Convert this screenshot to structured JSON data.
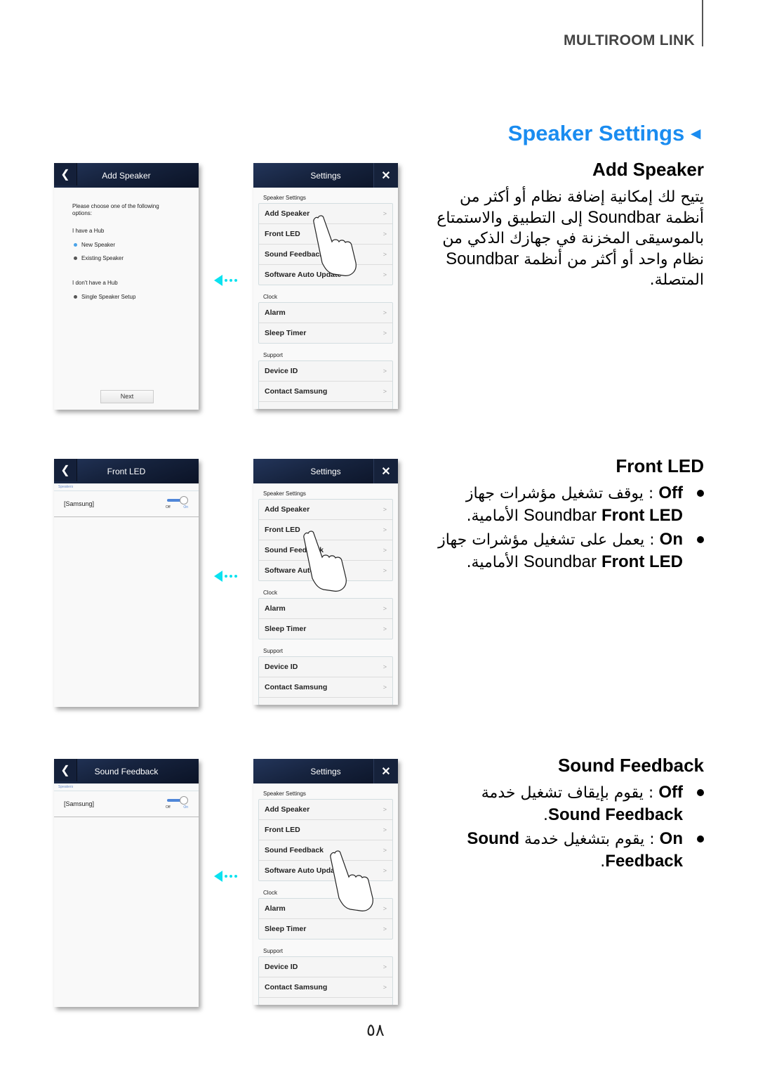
{
  "header": {
    "section": "MULTIROOM LINK"
  },
  "title": {
    "text": "Speaker Settings",
    "marker": "◄",
    "color": "#1a8cf0"
  },
  "accent_arrow_color": "#0ae2f0",
  "add_speaker": {
    "heading": "Add Speaker",
    "paragraph_parts": [
      "يتيح لك إمكانية إضافة نظام أو أكثر من أنظمة ",
      "Soundbar",
      " إلى التطبيق والاستمتاع بالموسيقى المخزنة في جهازك الذكي من نظام واحد أو أكثر من أنظمة ",
      "Soundbar",
      " المتصلة."
    ],
    "phone": {
      "title": "Add Speaker",
      "prompt": "Please choose one of the following options:",
      "group1": "I have a Hub",
      "opt_new": "New Speaker",
      "opt_existing": "Existing Speaker",
      "group2": "I don't have a Hub",
      "opt_single": "Single Speaker Setup",
      "next": "Next"
    }
  },
  "settings_menu": {
    "title": "Settings",
    "close": "✕",
    "group_speaker": "Speaker Settings",
    "items_speaker": [
      "Add Speaker",
      "Front LED",
      "Sound Feedback",
      "Software Auto Update"
    ],
    "group_clock": "Clock",
    "items_clock": [
      "Alarm",
      "Sleep Timer"
    ],
    "group_support": "Support",
    "items_support": [
      "Device ID",
      "Contact Samsung"
    ],
    "chevron": ">"
  },
  "front_led": {
    "heading": "Front LED",
    "phone": {
      "title": "Front LED",
      "speakers_label": "Speakers",
      "speaker": "[Samsung]",
      "off": "Off",
      "on": "On",
      "state": "on"
    },
    "bullets": [
      {
        "key": "Off",
        "sep": " : ",
        "text": "يوقف تشغيل مؤشرات جهاز ",
        "latin": "Soundbar",
        "bold": "Front LED",
        "tail": " الأمامية."
      },
      {
        "key": "On",
        "sep": " : ",
        "text": "يعمل على تشغيل مؤشرات جهاز ",
        "latin": "Soundbar",
        "bold": "Front LED",
        "tail": " الأمامية."
      }
    ]
  },
  "sound_feedback": {
    "heading": "Sound Feedback",
    "phone": {
      "title": "Sound Feedback",
      "speakers_label": "Speakers",
      "speaker": "[Samsung]",
      "off": "Off",
      "on": "On",
      "state": "on"
    },
    "bullets": [
      {
        "key": "Off",
        "sep": " : ",
        "text": "يقوم بإيقاف تشغيل خدمة ",
        "bold": "Sound Feedback",
        "tail": "."
      },
      {
        "key": "On",
        "sep": " : ",
        "text": "يقوم بتشغيل خدمة ",
        "bold": "Sound Feedback",
        "tail": "."
      }
    ]
  },
  "page_number": "٥٨"
}
